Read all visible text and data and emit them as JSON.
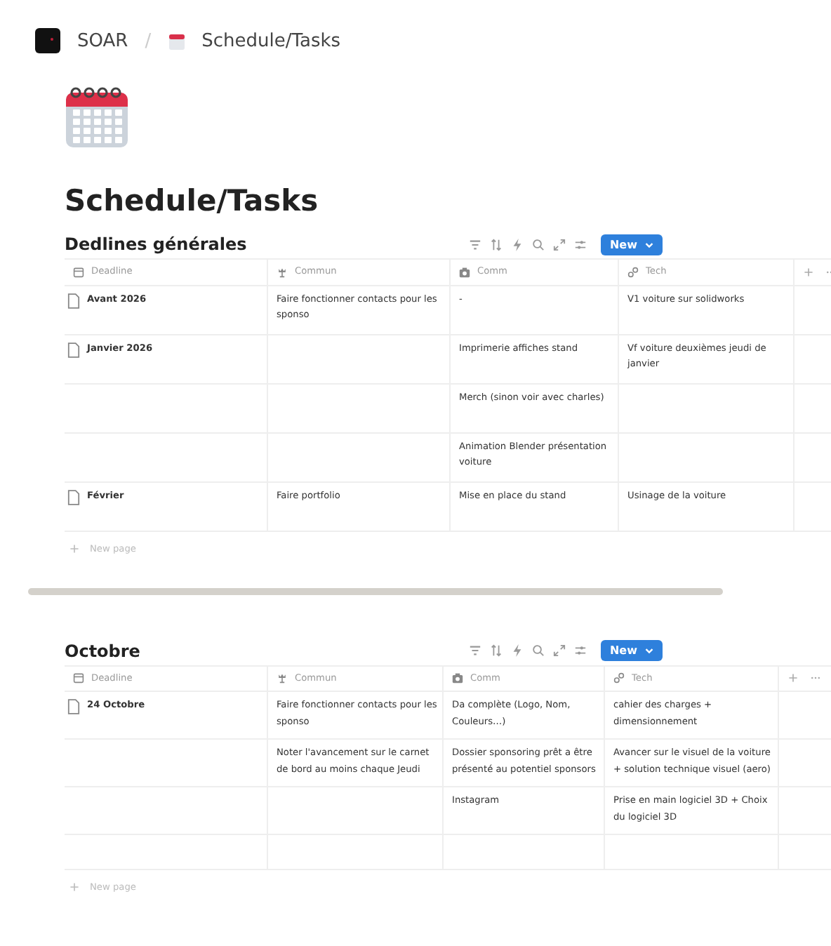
{
  "breadcrumb": {
    "workspace": "SOAR",
    "separator": "/",
    "page": "Schedule/Tasks"
  },
  "title": "Schedule/Tasks",
  "databases": [
    {
      "title": "Dedlines générales",
      "new_button": "New",
      "columns": [
        "Deadline",
        "Commun",
        "Comm",
        "Tech"
      ],
      "rows": [
        {
          "deadline": "Avant 2026",
          "commun": "Faire fonctionner contacts pour les sponso",
          "comm": "-",
          "tech": "V1 voiture sur solidworks"
        },
        {
          "deadline": "Janvier 2026",
          "comm": "Imprimerie affiches stand",
          "tech": "Vf voiture deuxièmes jeudi de janvier"
        },
        {
          "comm": "Merch (sinon voir avec charles)"
        },
        {
          "comm": "Animation Blender présentation voiture"
        },
        {
          "deadline": "Février",
          "commun": "Faire portfolio",
          "comm": "Mise en place du stand",
          "tech": "Usinage de la voiture"
        }
      ],
      "new_page": "New page"
    },
    {
      "title": "Octobre",
      "new_button": "New",
      "columns": [
        "Deadline",
        "Commun",
        "Comm",
        "Tech"
      ],
      "rows": [
        {
          "deadline": "24 Octobre",
          "commun": "Faire fonctionner contacts pour les sponso",
          "comm": "Da complète (Logo, Nom, Couleurs…)",
          "tech": "cahier des charges + dimensionnement"
        },
        {
          "commun": "Noter l'avancement sur le carnet de bord au moins chaque Jeudi",
          "comm": "Dossier sponsoring prêt a être présenté au potentiel sponsors",
          "tech": "Avancer sur le visuel de la voiture + solution technique visuel (aero)"
        },
        {
          "comm": "Instagram",
          "tech": "Prise en main logiciel 3D + Choix du logiciel 3D"
        },
        {}
      ],
      "new_page": "New page"
    }
  ]
}
